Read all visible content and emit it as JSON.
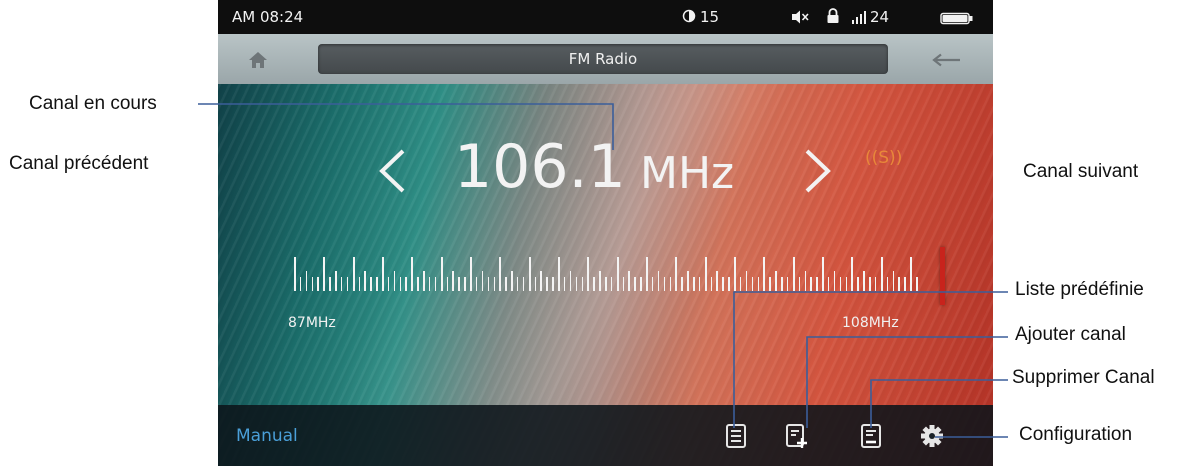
{
  "status_bar": {
    "clock": "AM 08:24",
    "brightness_value": "15",
    "signal_value": "24",
    "battery_level": 1.0
  },
  "title_bar": {
    "title": "FM Radio"
  },
  "tuner": {
    "frequency": "106.1",
    "unit": "MHz",
    "stereo_indicator": "((S))",
    "scale_min_label": "87MHz",
    "scale_max_label": "108MHz",
    "pointer_fraction": 0.913
  },
  "bottom_bar": {
    "mode_label": "Manual"
  },
  "callouts": {
    "current_channel": "Canal en cours",
    "previous_channel": "Canal précédent",
    "next_channel": "Canal suivant",
    "preset_list": "Liste prédéfinie",
    "add_channel": "Ajouter canal",
    "delete_channel": "Supprimer Canal",
    "configuration": "Configuration"
  },
  "colors": {
    "accent_blue": "#4a9fd8",
    "stereo_orange": "#e8883a",
    "pointer_red": "#c8231c",
    "callout_line": "#3b5e9a"
  }
}
